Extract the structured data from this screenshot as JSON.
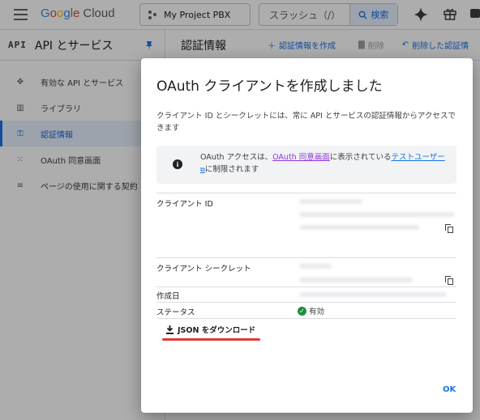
{
  "topbar": {
    "logo": {
      "g": "G",
      "o1": "o",
      "o2": "o",
      "g2": "g",
      "l": "l",
      "e": "e",
      "cloud": "Cloud"
    },
    "project": "My Project PBX",
    "search_placeholder": "スラッシュ（/）",
    "search_button": "検索"
  },
  "sidebar": {
    "api_label": "API",
    "title": "API とサービス",
    "items": [
      {
        "label": "有効な API とサービス",
        "icon": "apis-icon"
      },
      {
        "label": "ライブラリ",
        "icon": "library-icon"
      },
      {
        "label": "認証情報",
        "icon": "key-icon"
      },
      {
        "label": "OAuth 同意画面",
        "icon": "oauth-icon"
      },
      {
        "label": "ページの使用に関する契約",
        "icon": "agreement-icon"
      }
    ]
  },
  "main": {
    "title": "認証情報",
    "create": "認証情報を作成",
    "delete": "削除",
    "restore": "削除した認証情"
  },
  "dialog": {
    "title": "OAuth クライアントを作成しました",
    "description": "クライアント ID とシークレットには、常に API とサービスの認証情報からアクセスできます",
    "info": {
      "part1": "OAuth アクセスは、",
      "link1": "OAuth 同意画面",
      "part2": "に表示されている",
      "link2": "テストユーザー",
      "part3": "に制限されます"
    },
    "fields": {
      "client_id_label": "クライアント ID",
      "client_secret_label": "クライアント シークレット",
      "created_label": "作成日",
      "status_label": "ステータス",
      "status_value": "有効"
    },
    "download_label": "JSON をダウンロード",
    "ok_label": "OK"
  },
  "colors": {
    "accent": "#1a73e8",
    "visited_link": "#9334e6",
    "success": "#1e8e3e",
    "annotation": "#e53935"
  }
}
